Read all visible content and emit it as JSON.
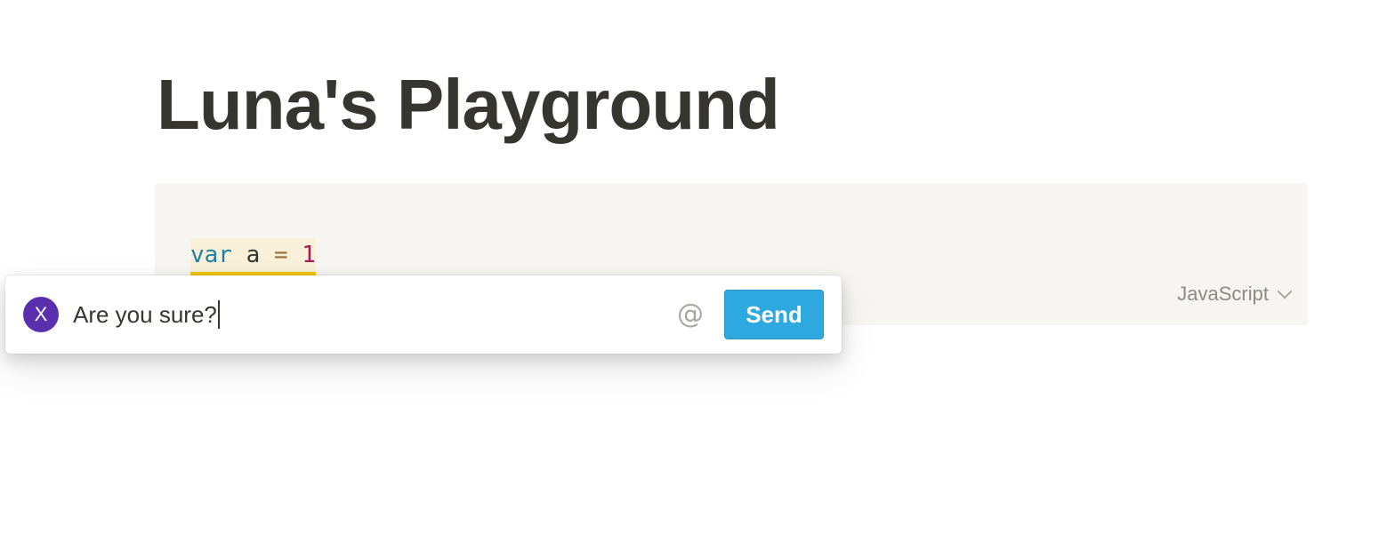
{
  "page": {
    "title": "Luna's Playground"
  },
  "code_block": {
    "tokens": {
      "keyword": "var",
      "space1": " ",
      "identifier": "a",
      "space2": " ",
      "operator": "=",
      "space3": " ",
      "number": "1"
    },
    "language": "JavaScript",
    "language_icon": "chevron-down-icon"
  },
  "comment": {
    "avatar_initial": "X",
    "avatar_color": "#5a2fae",
    "input_value": "Are you sure?",
    "mention_symbol": "@",
    "send_label": "Send",
    "send_color": "#2ea9df"
  },
  "colors": {
    "highlight_underline": "#f1c40f",
    "highlight_background": "#f8f0d8",
    "code_background": "#f6f5f2"
  }
}
